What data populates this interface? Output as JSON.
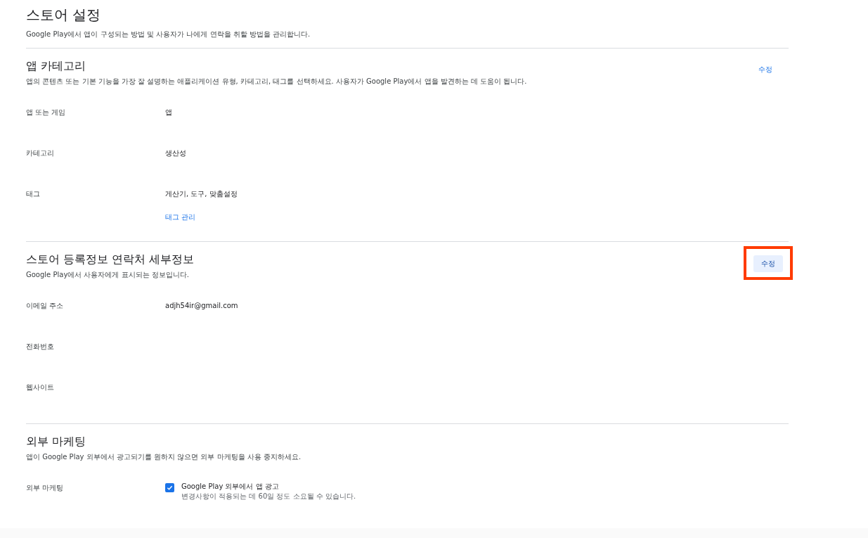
{
  "page": {
    "title": "스토어 설정",
    "description": "Google Play에서 앱이 구성되는 방법 및 사용자가 나에게 연락을 취할 방법을 관리합니다."
  },
  "sections": [
    {
      "title": "앱 카테고리",
      "description": "앱의 콘텐츠 또는 기본 기능을 가장 잘 설명하는 애플리케이션 유형, 카테고리, 태그를 선택하세요. 사용자가 Google Play에서 앱을 발견하는 데 도움이 됩니다.",
      "edit": {
        "label": "수정",
        "highlighted": false
      },
      "rows": [
        {
          "kind": "text",
          "label": "앱 또는 게임",
          "value": "앱"
        },
        {
          "kind": "text",
          "label": "카테고리",
          "value": "생산성"
        },
        {
          "kind": "text",
          "label": "태그",
          "value": "게산기, 도구, 맞춤설정",
          "link": "태그 관리"
        }
      ]
    },
    {
      "title": "스토어 등록정보 연락처 세부정보",
      "description": "Google Play에서 사용자에게 표시되는 정보입니다.",
      "edit": {
        "label": "수정",
        "highlighted": true
      },
      "rows": [
        {
          "kind": "text",
          "label": "이메일 주소",
          "value": "adjh54ir@gmail.com"
        },
        {
          "kind": "text",
          "label": "전화번호"
        },
        {
          "kind": "text",
          "label": "웹사이트"
        }
      ]
    },
    {
      "title": "외부 마케팅",
      "description": "앱이 Google Play 외부에서 광고되기를 원하지 않으면 외부 마케팅을 사용 중지하세요.",
      "rows": [
        {
          "kind": "checkbox",
          "label": "외부 마케팅",
          "checked": true,
          "value": "Google Play 외부에서 앱 광고",
          "note": "변경사항이 적용되는 데 60일 정도 소요될 수 있습니다."
        }
      ]
    }
  ]
}
